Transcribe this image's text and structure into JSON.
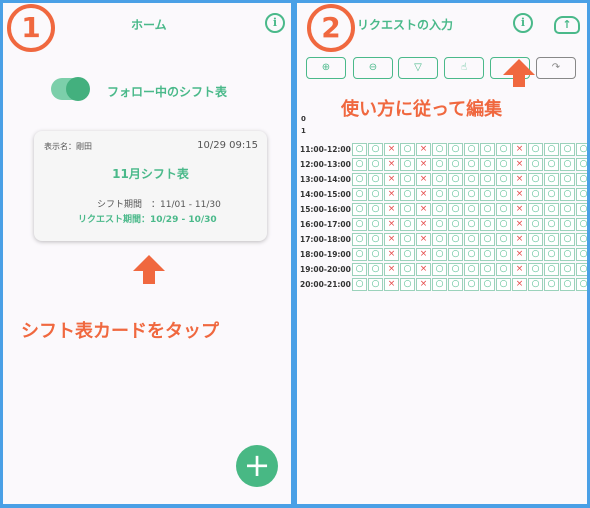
{
  "step1": {
    "number": "1",
    "title": "ホーム",
    "info": "i",
    "toggle_label": "フォロー中のシフト表",
    "card": {
      "display_name": "表示名：剛田",
      "timestamp": "10/29 09:15",
      "title": "11月シフト表",
      "shift_period": "シフト期間　：11/01 - 11/30",
      "request_period": "リクエスト期間：10/29 - 10/30"
    },
    "instruction": "シフト表カードをタップ",
    "fab": "+"
  },
  "step2": {
    "number": "2",
    "title": "リクエストの入力",
    "back": "<",
    "info": "i",
    "upload": "↑",
    "toolbar": [
      "⊕",
      "⊖",
      "▽",
      "☝",
      "",
      "↷"
    ],
    "instruction": "使い方に従って編集",
    "hidden_rows": [
      "0",
      "1"
    ],
    "rows": [
      {
        "time": "11:00-12:00",
        "cells": [
          "○",
          "○",
          "×",
          "○",
          "×",
          "○",
          "○",
          "○",
          "○",
          "○",
          "×",
          "○",
          "○",
          "○",
          "○",
          "○"
        ]
      },
      {
        "time": "12:00-13:00",
        "cells": [
          "○",
          "○",
          "×",
          "○",
          "×",
          "○",
          "○",
          "○",
          "○",
          "○",
          "×",
          "○",
          "○",
          "○",
          "○",
          "○"
        ]
      },
      {
        "time": "13:00-14:00",
        "cells": [
          "○",
          "○",
          "×",
          "○",
          "×",
          "○",
          "○",
          "○",
          "○",
          "○",
          "×",
          "○",
          "○",
          "○",
          "○",
          "○"
        ]
      },
      {
        "time": "14:00-15:00",
        "cells": [
          "○",
          "○",
          "×",
          "○",
          "×",
          "○",
          "○",
          "○",
          "○",
          "○",
          "×",
          "○",
          "○",
          "○",
          "○",
          "○"
        ]
      },
      {
        "time": "15:00-16:00",
        "cells": [
          "○",
          "○",
          "×",
          "○",
          "×",
          "○",
          "○",
          "○",
          "○",
          "○",
          "×",
          "○",
          "○",
          "○",
          "○",
          "○"
        ]
      },
      {
        "time": "16:00-17:00",
        "cells": [
          "○",
          "○",
          "×",
          "○",
          "×",
          "○",
          "○",
          "○",
          "○",
          "○",
          "×",
          "○",
          "○",
          "○",
          "○",
          "○"
        ]
      },
      {
        "time": "17:00-18:00",
        "cells": [
          "○",
          "○",
          "×",
          "○",
          "×",
          "○",
          "○",
          "○",
          "○",
          "○",
          "×",
          "○",
          "○",
          "○",
          "○",
          "○"
        ]
      },
      {
        "time": "18:00-19:00",
        "cells": [
          "○",
          "○",
          "×",
          "○",
          "×",
          "○",
          "○",
          "○",
          "○",
          "○",
          "×",
          "○",
          "○",
          "○",
          "○",
          "○"
        ]
      },
      {
        "time": "19:00-20:00",
        "cells": [
          "○",
          "○",
          "×",
          "○",
          "×",
          "○",
          "○",
          "○",
          "○",
          "○",
          "×",
          "○",
          "○",
          "○",
          "○",
          "○"
        ]
      },
      {
        "time": "20:00-21:00",
        "cells": [
          "○",
          "○",
          "×",
          "○",
          "×",
          "○",
          "○",
          "○",
          "○",
          "○",
          "×",
          "○",
          "○",
          "○",
          "○",
          "○"
        ]
      }
    ]
  },
  "colors": {
    "accent": "#4ab98a",
    "annotation": "#f0683f",
    "border": "#4aa0e6",
    "cross": "#e54b4b"
  }
}
